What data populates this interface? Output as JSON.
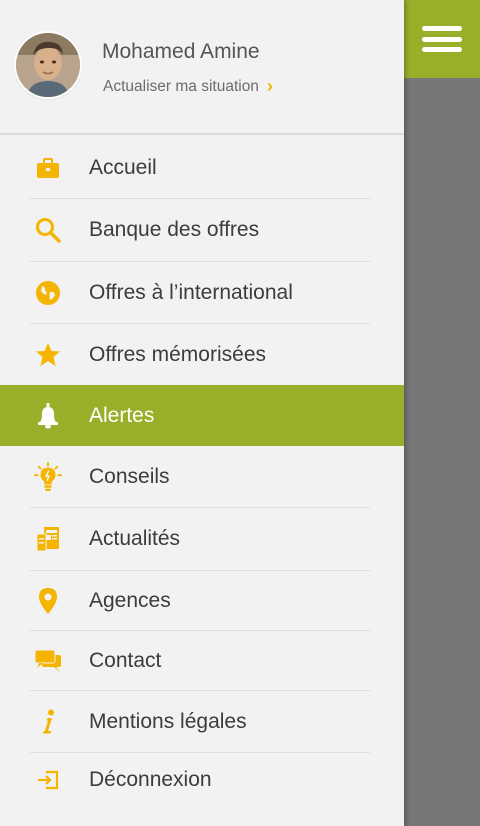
{
  "profile": {
    "name": "Mohamed Amine",
    "status_link": "Actualiser ma situation",
    "chevron": "›"
  },
  "menu": {
    "items": [
      {
        "label": "Accueil",
        "icon": "briefcase-icon"
      },
      {
        "label": "Banque des offres",
        "icon": "search-icon"
      },
      {
        "label": "Offres à l’international",
        "icon": "globe-icon"
      },
      {
        "label": "Offres mémorisées",
        "icon": "star-icon"
      },
      {
        "label": "Alertes",
        "icon": "bell-icon",
        "active": true
      },
      {
        "label": "Conseils",
        "icon": "lightbulb-icon"
      },
      {
        "label": "Actualités",
        "icon": "newspaper-icon"
      },
      {
        "label": "Agences",
        "icon": "map-pin-icon"
      },
      {
        "label": "Contact",
        "icon": "chat-bubbles-icon"
      },
      {
        "label": "Mentions légales",
        "icon": "info-icon"
      },
      {
        "label": "Déconnexion",
        "icon": "logout-icon"
      }
    ]
  },
  "colors": {
    "accent": "#9bae2a",
    "icon": "#f5b400",
    "overlay": "#777777",
    "drawer_bg": "#f2f2f2"
  }
}
